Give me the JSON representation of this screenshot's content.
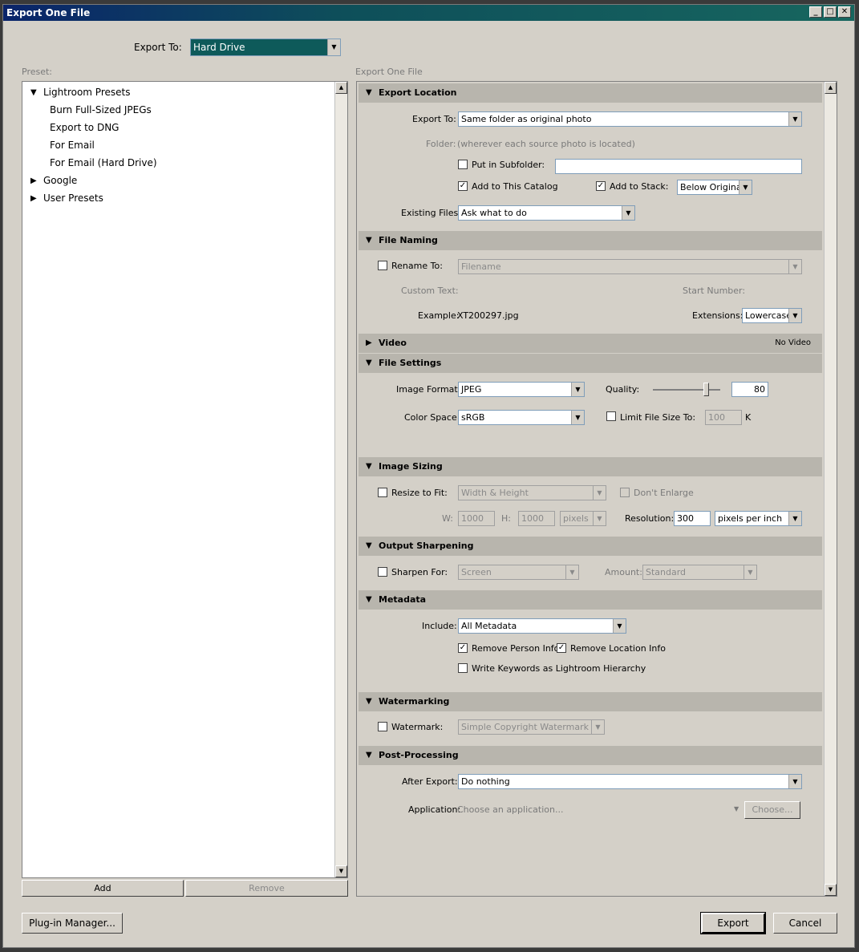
{
  "window": {
    "title": "Export One File"
  },
  "export_to": {
    "label": "Export To:",
    "value": "Hard Drive"
  },
  "preset": {
    "header": "Preset:",
    "groups": [
      {
        "label": "Lightroom Presets",
        "expanded": true,
        "items": [
          "Burn Full-Sized JPEGs",
          "Export to DNG",
          "For Email",
          "For Email (Hard Drive)"
        ]
      },
      {
        "label": "Google",
        "expanded": false
      },
      {
        "label": "User Presets",
        "expanded": false
      }
    ],
    "add_label": "Add",
    "remove_label": "Remove"
  },
  "right_header": "Export One File",
  "export_location": {
    "title": "Export Location",
    "export_to_label": "Export To:",
    "export_to_value": "Same folder as original photo",
    "folder_label": "Folder:",
    "folder_value": "(wherever each source photo is located)",
    "subfolder_label": "Put in Subfolder:",
    "subfolder_checked": false,
    "subfolder_value": "",
    "add_catalog_label": "Add to This Catalog",
    "add_catalog_checked": true,
    "add_stack_label": "Add to Stack:",
    "add_stack_checked": true,
    "stack_value": "Below Original",
    "existing_label": "Existing Files:",
    "existing_value": "Ask what to do"
  },
  "file_naming": {
    "title": "File Naming",
    "rename_label": "Rename To:",
    "rename_checked": false,
    "rename_value": "Filename",
    "custom_text_label": "Custom Text:",
    "start_number_label": "Start Number:",
    "example_label": "Example:",
    "example_value": "XT200297.jpg",
    "extensions_label": "Extensions:",
    "extensions_value": "Lowercase"
  },
  "video": {
    "title": "Video",
    "status": "No Video"
  },
  "file_settings": {
    "title": "File Settings",
    "format_label": "Image Format:",
    "format_value": "JPEG",
    "quality_label": "Quality:",
    "quality_value": "80",
    "quality_level": 80,
    "color_space_label": "Color Space:",
    "color_space_value": "sRGB",
    "limit_label": "Limit File Size To:",
    "limit_checked": false,
    "limit_value": "100",
    "limit_unit": "K"
  },
  "image_sizing": {
    "title": "Image Sizing",
    "resize_label": "Resize to Fit:",
    "resize_checked": false,
    "resize_value": "Width & Height",
    "dont_enlarge_label": "Don't Enlarge",
    "w_label": "W:",
    "w_value": "1000",
    "h_label": "H:",
    "h_value": "1000",
    "unit_value": "pixels",
    "resolution_label": "Resolution:",
    "resolution_value": "300",
    "resolution_unit": "pixels per inch"
  },
  "output_sharpening": {
    "title": "Output Sharpening",
    "sharpen_label": "Sharpen For:",
    "sharpen_checked": false,
    "sharpen_value": "Screen",
    "amount_label": "Amount:",
    "amount_value": "Standard"
  },
  "metadata": {
    "title": "Metadata",
    "include_label": "Include:",
    "include_value": "All Metadata",
    "remove_person_label": "Remove Person Info",
    "remove_person_checked": true,
    "remove_location_label": "Remove Location Info",
    "remove_location_checked": true,
    "keywords_label": "Write Keywords as Lightroom Hierarchy",
    "keywords_checked": false
  },
  "watermarking": {
    "title": "Watermarking",
    "watermark_label": "Watermark:",
    "watermark_checked": false,
    "watermark_value": "Simple Copyright Watermark"
  },
  "post_processing": {
    "title": "Post-Processing",
    "after_label": "After Export:",
    "after_value": "Do nothing",
    "app_label": "Application:",
    "app_value": "Choose an application...",
    "choose_label": "Choose..."
  },
  "footer": {
    "plugin_label": "Plug-in Manager...",
    "export_label": "Export",
    "cancel_label": "Cancel"
  },
  "glyphs": {
    "check": "✓",
    "down": "▼",
    "up": "▲",
    "tri_open": "▼",
    "tri_closed": "▶",
    "min": "_",
    "max": "□",
    "close": "✕"
  }
}
